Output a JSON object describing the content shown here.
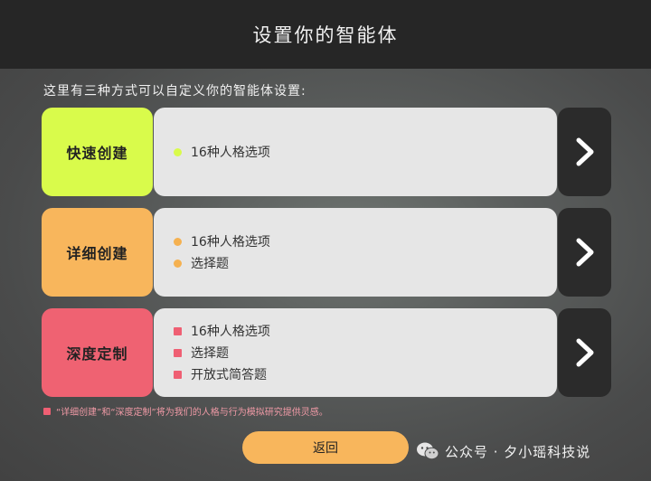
{
  "header": {
    "title": "设置你的智能体"
  },
  "subtitle": "这里有三种方式可以自定义你的智能体设置:",
  "options": [
    {
      "label": "快速创建",
      "items": [
        "16种人格选项"
      ]
    },
    {
      "label": "详细创建",
      "items": [
        "16种人格选项",
        "选择题"
      ]
    },
    {
      "label": "深度定制",
      "items": [
        "16种人格选项",
        "选择题",
        "开放式简答题"
      ]
    }
  ],
  "note": "“详细创建”和“深度定制”将为我们的人格与行为模拟研究提供灵感。",
  "back_label": "返回",
  "watermark": "公众号 · 夕小瑶科技说",
  "colors": {
    "quick": "#d9fb4b",
    "detailed": "#f8b65c",
    "deep": "#ef6272",
    "arrow_bg": "#2b2b2b",
    "content_bg": "#e6e6e6"
  },
  "icons": {
    "arrow": "chevron-right-icon",
    "watermark": "wechat-icon"
  }
}
